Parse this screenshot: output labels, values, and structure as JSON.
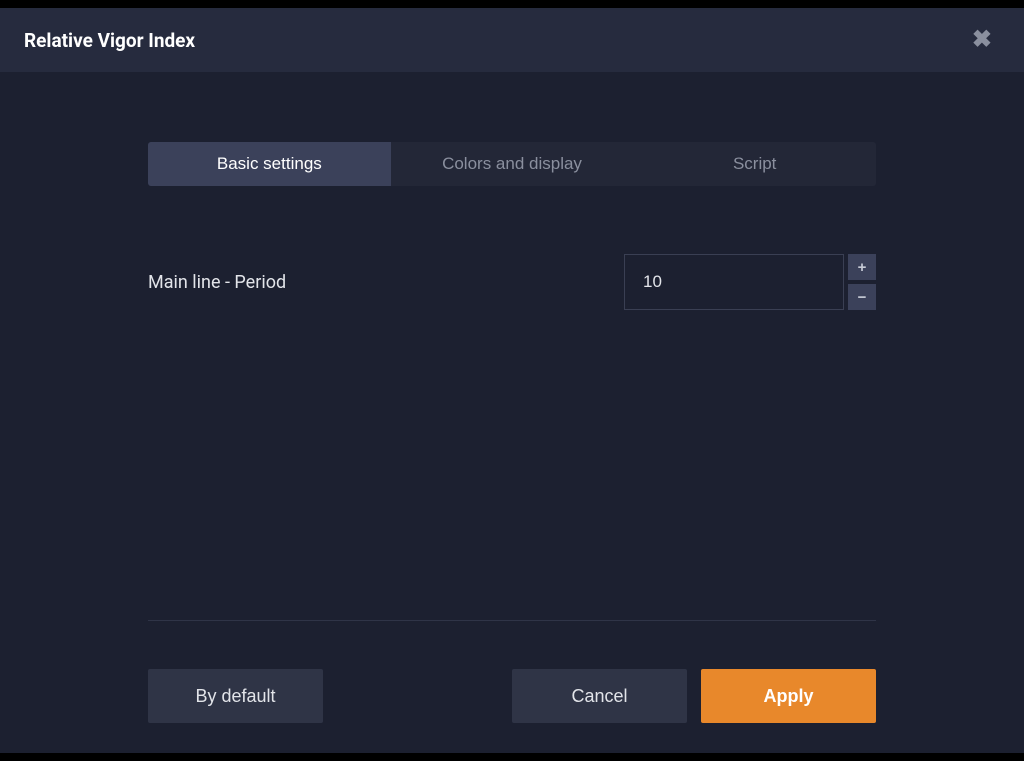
{
  "modal": {
    "title": "Relative Vigor Index",
    "close_icon": "✖"
  },
  "tabs": [
    {
      "label": "Basic settings",
      "active": true
    },
    {
      "label": "Colors and display",
      "active": false
    },
    {
      "label": "Script",
      "active": false
    }
  ],
  "settings": {
    "main_line_period": {
      "label": "Main line - Period",
      "value": "10"
    }
  },
  "stepper": {
    "plus": "+",
    "minus": "−"
  },
  "footer": {
    "by_default": "By default",
    "cancel": "Cancel",
    "apply": "Apply"
  }
}
